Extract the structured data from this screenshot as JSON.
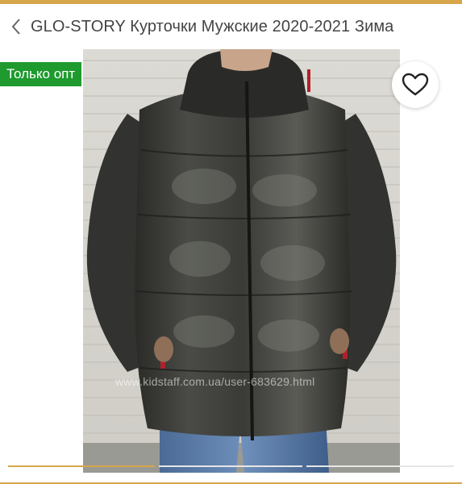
{
  "header": {
    "back_icon": "chevron-left-icon",
    "title": "GLO-STORY Курточки Мужские 2020-2021 Зима"
  },
  "badge": {
    "label": "Только опт",
    "color": "#1e9a2e"
  },
  "favorite": {
    "icon": "heart-outline-icon"
  },
  "photo": {
    "watermark": "www.kidstaff.com.ua/user-683629.html"
  },
  "gallery": {
    "slides_total": 3,
    "active_slide": 1
  },
  "colors": {
    "accent": "#d8a64a",
    "badge": "#1e9a2e",
    "text": "#444444"
  }
}
